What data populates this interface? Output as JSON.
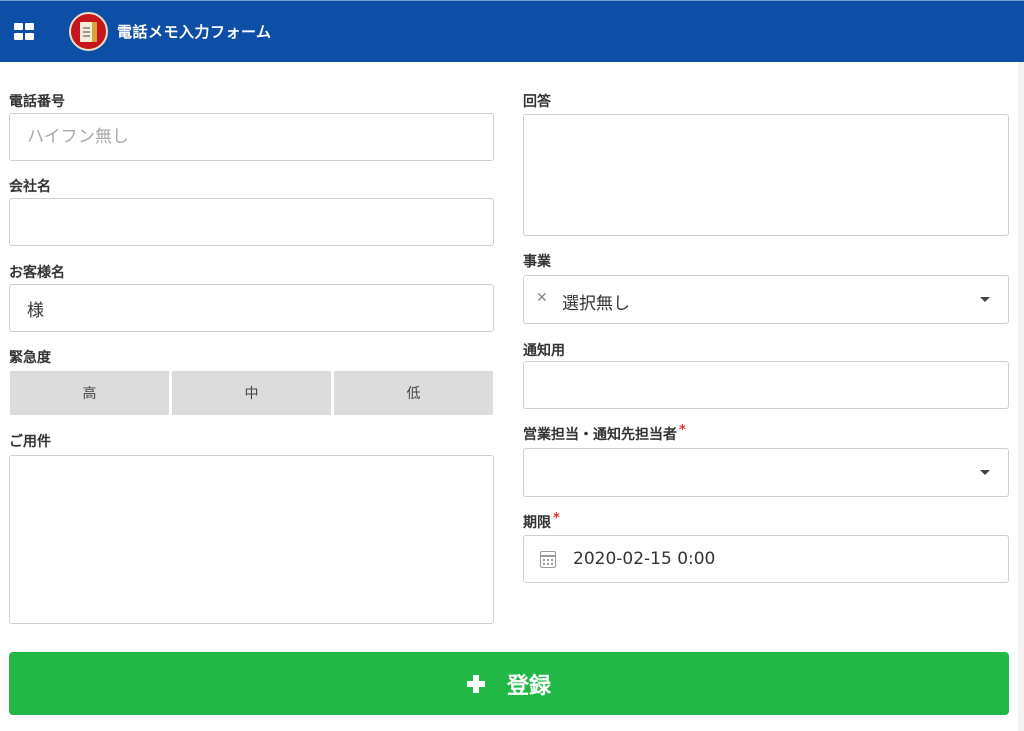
{
  "header": {
    "title": "電話メモ入力フォーム",
    "menu_icon": "grid-icon",
    "logo_icon": "book-logo-icon"
  },
  "left": {
    "phone": {
      "label": "電話番号",
      "placeholder": "ハイフン無し",
      "value": ""
    },
    "company": {
      "label": "会社名",
      "value": ""
    },
    "customer": {
      "label": "お客様名",
      "value": "様"
    },
    "urgency": {
      "label": "緊急度",
      "options": [
        "高",
        "中",
        "低"
      ]
    },
    "matter": {
      "label": "ご用件",
      "value": ""
    }
  },
  "right": {
    "answer": {
      "label": "回答",
      "value": ""
    },
    "business": {
      "label": "事業",
      "value": "選択無し",
      "clear_icon": "clear-x-icon"
    },
    "notify": {
      "label": "通知用",
      "value": ""
    },
    "staff": {
      "label": "営業担当・通知先担当者",
      "required_mark": "*",
      "value": ""
    },
    "deadline": {
      "label": "期限",
      "required_mark": "*",
      "value": "2020-02-15 0:00",
      "icon": "calendar-icon"
    }
  },
  "submit": {
    "label": "登録",
    "icon": "plus-icon"
  },
  "colors": {
    "header": "#0d4ea6",
    "submit": "#22b845",
    "required": "#e0302c"
  }
}
